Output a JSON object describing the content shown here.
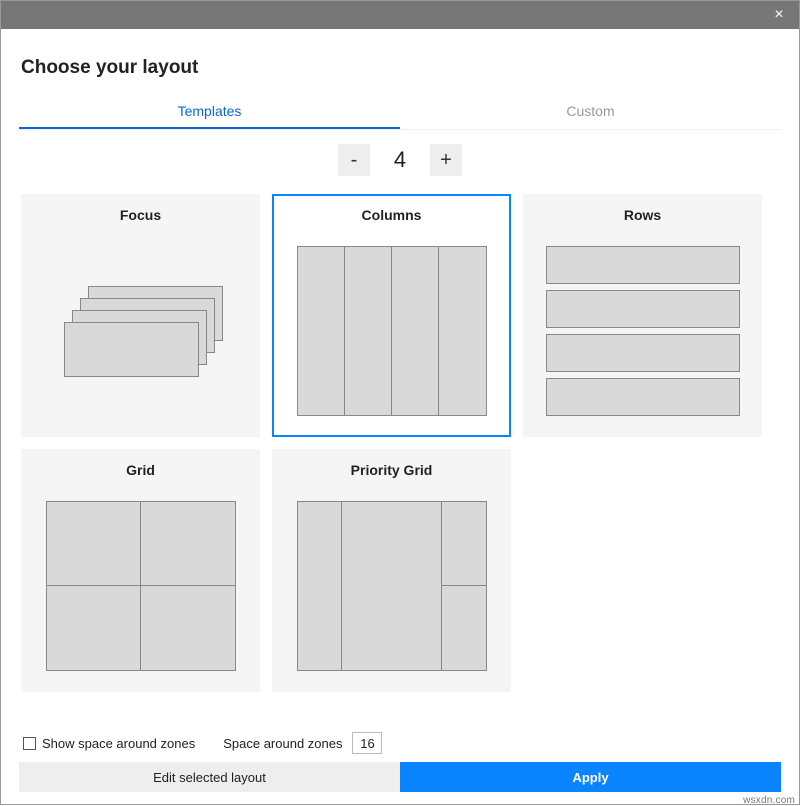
{
  "titlebar": {
    "close_glyph": "×"
  },
  "header": {
    "title": "Choose your layout"
  },
  "tabs": {
    "templates": "Templates",
    "custom": "Custom",
    "active": "templates"
  },
  "stepper": {
    "minus": "-",
    "plus": "+",
    "value": "4"
  },
  "templates": {
    "focus": "Focus",
    "columns": "Columns",
    "rows": "Rows",
    "grid": "Grid",
    "priority_grid": "Priority Grid"
  },
  "footer": {
    "show_space_label": "Show space around zones",
    "show_space_checked": false,
    "space_label": "Space around zones",
    "space_value": "16"
  },
  "actions": {
    "edit": "Edit selected layout",
    "apply": "Apply"
  },
  "watermark": "wsxdn.com"
}
